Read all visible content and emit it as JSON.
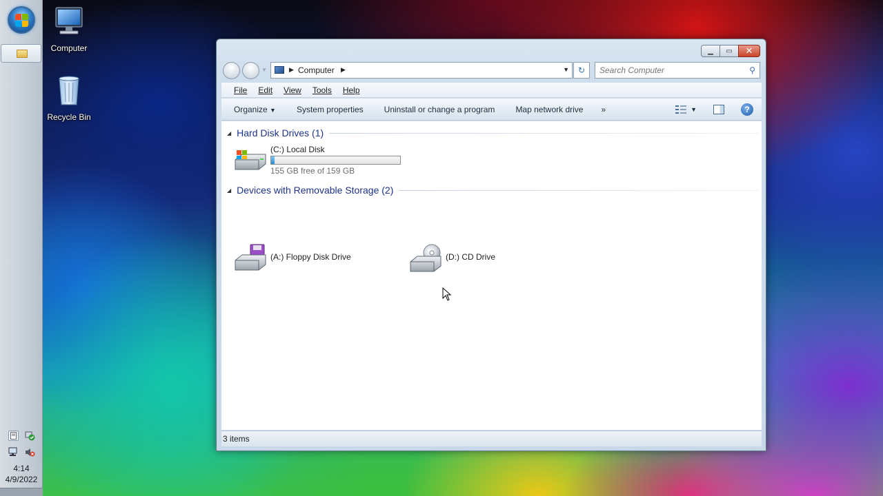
{
  "desktop": {
    "icons": [
      {
        "label": "Computer"
      },
      {
        "label": "Recycle Bin"
      }
    ]
  },
  "taskbar": {
    "clock_time": "4:14",
    "clock_date": "4/9/2022"
  },
  "window": {
    "address": {
      "crumb": "Computer"
    },
    "search": {
      "placeholder": "Search Computer"
    },
    "menu": [
      "File",
      "Edit",
      "View",
      "Tools",
      "Help"
    ],
    "commands": {
      "organize": "Organize",
      "system_properties": "System properties",
      "uninstall": "Uninstall or change a program",
      "map_drive": "Map network drive",
      "more": "»"
    },
    "groups": {
      "hard_disks": {
        "title": "Hard Disk Drives (1)",
        "drives": [
          {
            "name": "(C:) Local Disk",
            "free_text": "155 GB free of 159 GB",
            "used_fraction": 0.025
          }
        ]
      },
      "removable": {
        "title": "Devices with Removable Storage (2)",
        "drives": [
          {
            "name": "(A:) Floppy Disk Drive"
          },
          {
            "name": "(D:) CD Drive"
          }
        ]
      }
    },
    "status": "3 items"
  },
  "colors": {
    "group_header": "#1e3287",
    "capacity_fill": "#2a8fd6"
  }
}
